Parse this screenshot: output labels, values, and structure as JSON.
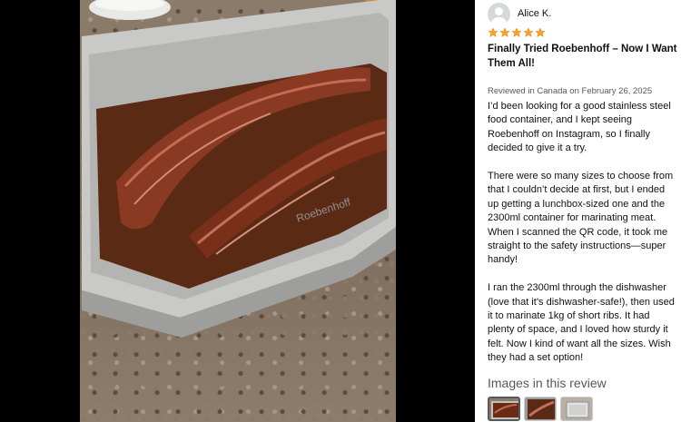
{
  "photo": {
    "image_icon": "review-photo-marinated-short-ribs",
    "embossed_brand": "Roebenhoff"
  },
  "reviewer": {
    "name": "Alice K.",
    "avatar_icon": "user-avatar-icon"
  },
  "rating": {
    "value": 5,
    "max": 5,
    "star_color": "#ffa41c"
  },
  "review": {
    "title": "Finally Tried Roebenhoff – Now I Want Them All!",
    "meta": "Reviewed in Canada on February 26, 2025",
    "paragraphs": [
      "I’d been looking for a good stainless steel food container, and I kept seeing Roebenhoff on Instagram, so I finally decided to give it a try.",
      "There were so many sizes to choose from that I couldn’t decide at first, but I ended up getting a lunchbox-sized one and the 2300ml container for marinating meat. When I scanned the QR code, it took me straight to the safety instructions—super handy!",
      "I ran the 2300ml through the dishwasher (love that it’s dishwasher-safe!), then used it to marinate 1kg of short ribs. It had plenty of space, and I loved how sturdy it felt. Now I kind of want all the sizes. Wish they had a set option!"
    ]
  },
  "images_section": {
    "heading": "Images in this review",
    "thumbnails": [
      {
        "icon": "thumbnail-short-ribs",
        "selected": true
      },
      {
        "icon": "thumbnail-ribs-closeup",
        "selected": false
      },
      {
        "icon": "thumbnail-empty-container",
        "selected": false
      }
    ]
  },
  "colors": {
    "media_background": "#000000",
    "text_primary": "#0f1111",
    "text_secondary": "#565959"
  }
}
